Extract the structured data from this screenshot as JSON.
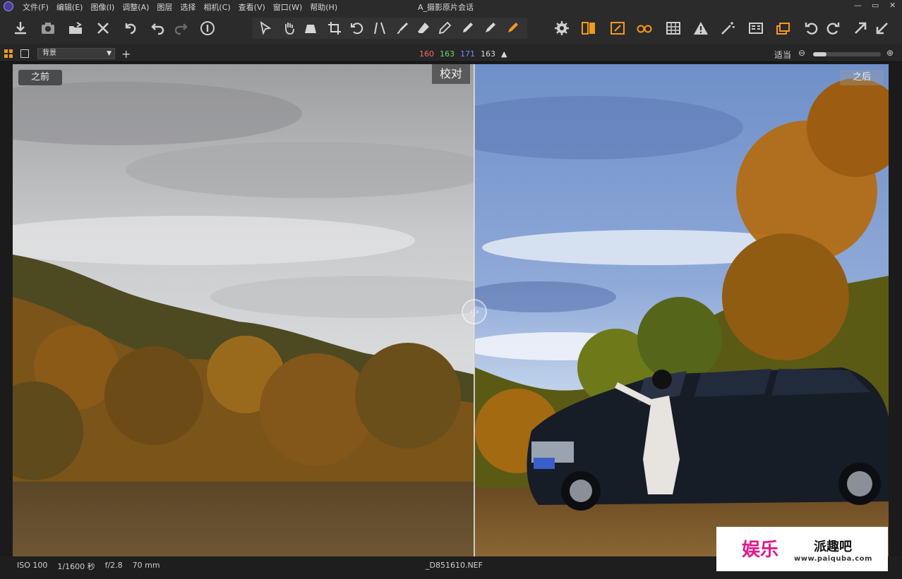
{
  "titlebar": {
    "window_title": "A_摄影原片会话",
    "menu": [
      "文件(F)",
      "编辑(E)",
      "图像(I)",
      "调整(A)",
      "图层",
      "选择",
      "相机(C)",
      "查看(V)",
      "窗口(W)",
      "帮助(H)"
    ],
    "controls": [
      "—",
      "▭",
      "✕"
    ]
  },
  "subbar": {
    "layer": "背景",
    "rgb": {
      "r": "160",
      "g": "163",
      "b": "171",
      "l": "163"
    },
    "zoom_label": "适当",
    "zoom_level": 0.2
  },
  "viewer": {
    "before_label": "之前",
    "after_label": "之后",
    "proof_label": "校对",
    "divider_glyph": "‹|›"
  },
  "status": {
    "iso": "ISO 100",
    "shutter": "1/1600 秒",
    "aperture": "f/2.8",
    "focal": "70 mm",
    "filename": "_D851610.NEF"
  },
  "watermark": {
    "logo_text": "娱乐",
    "name": "派趣吧",
    "url": "www.paiquba.com"
  },
  "colors": {
    "accent_orange": "#f29a1e",
    "rgb_red": "#ff6b6b",
    "rgb_green": "#6fdc6f",
    "rgb_blue": "#7b8cff"
  }
}
